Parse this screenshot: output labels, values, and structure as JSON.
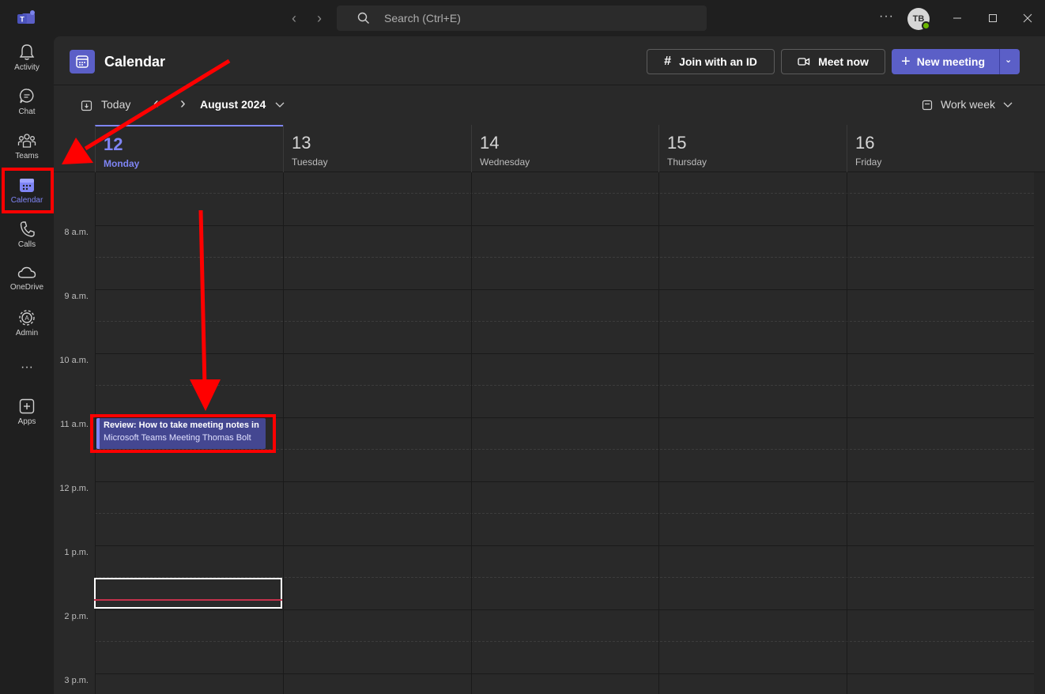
{
  "titlebar": {
    "search_placeholder": "Search (Ctrl+E)",
    "more": "···",
    "avatar_initials": "TB"
  },
  "rail": {
    "items": [
      {
        "label": "Activity",
        "icon": "bell-icon"
      },
      {
        "label": "Chat",
        "icon": "chat-icon"
      },
      {
        "label": "Teams",
        "icon": "teams-icon"
      },
      {
        "label": "Calendar",
        "icon": "calendar-icon"
      },
      {
        "label": "Calls",
        "icon": "phone-icon"
      },
      {
        "label": "OneDrive",
        "icon": "cloud-icon"
      },
      {
        "label": "Admin",
        "icon": "admin-icon"
      },
      {
        "label": "Apps",
        "icon": "plus-square-icon"
      }
    ],
    "more": "···"
  },
  "header": {
    "title": "Calendar",
    "join_with_id": "Join with an ID",
    "meet_now": "Meet now",
    "new_meeting": "New meeting"
  },
  "toolbar": {
    "today": "Today",
    "month": "August 2024",
    "view": "Work week"
  },
  "days": [
    {
      "num": "12",
      "name": "Monday"
    },
    {
      "num": "13",
      "name": "Tuesday"
    },
    {
      "num": "14",
      "name": "Wednesday"
    },
    {
      "num": "15",
      "name": "Thursday"
    },
    {
      "num": "16",
      "name": "Friday"
    }
  ],
  "times": [
    "8 a.m.",
    "9 a.m.",
    "10 a.m.",
    "11 a.m.",
    "12 p.m.",
    "1 p.m.",
    "2 p.m.",
    "3 p.m."
  ],
  "event": {
    "title": "Review: How to take meeting notes in",
    "subtitle": "Microsoft Teams Meeting  Thomas Bolt"
  },
  "colors": {
    "accent": "#5b5fc7",
    "today": "#7f85f5",
    "annotation": "#ff0000"
  }
}
